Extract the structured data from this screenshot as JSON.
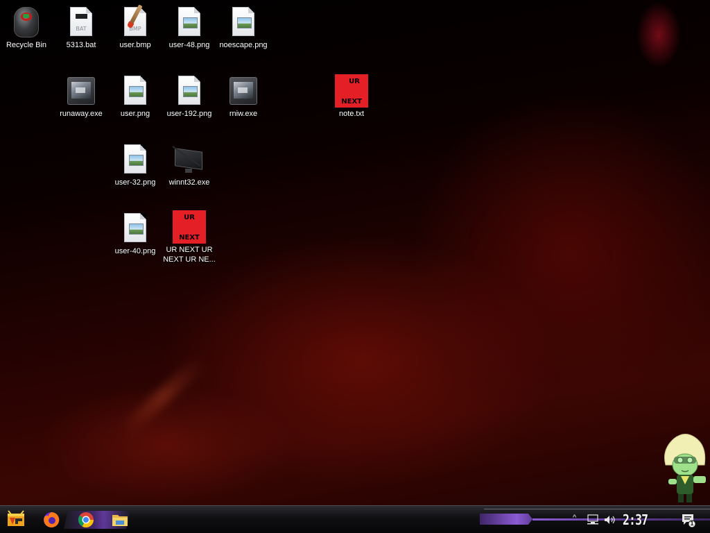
{
  "desktop": {
    "icons": [
      {
        "id": "recycle-bin",
        "label": "Recycle Bin"
      },
      {
        "id": "5313-bat",
        "label": "5313.bat",
        "badge": "BAT"
      },
      {
        "id": "user-bmp",
        "label": "user.bmp",
        "badge": "BMP"
      },
      {
        "id": "user-48-png",
        "label": "user-48.png"
      },
      {
        "id": "noescape-png",
        "label": "noescape.png"
      },
      {
        "id": "runaway-exe",
        "label": "runaway.exe"
      },
      {
        "id": "user-png",
        "label": "user.png"
      },
      {
        "id": "user-192-png",
        "label": "user-192.png"
      },
      {
        "id": "rniw-exe",
        "label": "rniw.exe"
      },
      {
        "id": "note-txt",
        "label": "note.txt",
        "thumb_top": "UR",
        "thumb_bottom": "NEXT"
      },
      {
        "id": "user-32-png",
        "label": "user-32.png"
      },
      {
        "id": "winnt32-exe",
        "label": "winnt32.exe"
      },
      {
        "id": "user-40-png",
        "label": "user-40.png"
      },
      {
        "id": "ur-next-file",
        "label": "UR NEXT UR NEXT UR NE...",
        "thumb_top": "UR",
        "thumb_bottom": "NEXT"
      }
    ]
  },
  "taskbar": {
    "start_icon": "start-logo-icon",
    "pinned": [
      {
        "id": "firefox",
        "icon": "firefox-icon"
      },
      {
        "id": "chrome",
        "icon": "chrome-icon"
      },
      {
        "id": "file-explorer",
        "icon": "folder-icon"
      }
    ],
    "tray": {
      "chevron": "^",
      "clock": "2:37 PM",
      "notification_count": "1"
    }
  },
  "colors": {
    "ur_next_red": "#e51f26",
    "accent_purple": "#8c5bd4"
  }
}
